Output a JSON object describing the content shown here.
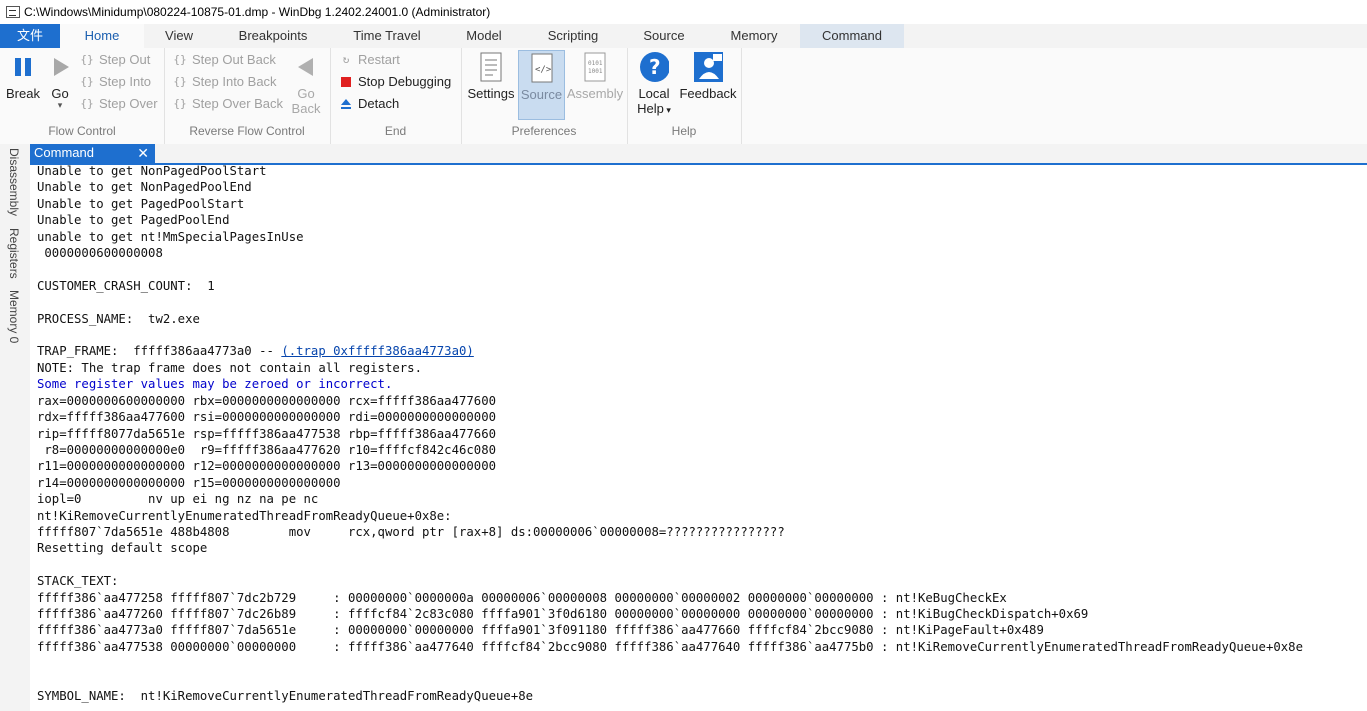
{
  "window": {
    "title": "C:\\Windows\\Minidump\\080224-10875-01.dmp - WinDbg 1.2402.24001.0 (Administrator)"
  },
  "tabs": [
    {
      "label": "文件"
    },
    {
      "label": "Home"
    },
    {
      "label": "View"
    },
    {
      "label": "Breakpoints"
    },
    {
      "label": "Time Travel"
    },
    {
      "label": "Model"
    },
    {
      "label": "Scripting"
    },
    {
      "label": "Source"
    },
    {
      "label": "Memory"
    },
    {
      "label": "Command"
    }
  ],
  "ribbon": {
    "flow_control": {
      "label": "Flow Control",
      "break": "Break",
      "go": "Go",
      "step_out": "Step Out",
      "step_into": "Step Into",
      "step_over": "Step Over"
    },
    "reverse_flow": {
      "label": "Reverse Flow Control",
      "step_out_back": "Step Out Back",
      "step_into_back": "Step Into Back",
      "step_over_back": "Step Over Back",
      "go_back_1": "Go",
      "go_back_2": "Back"
    },
    "end": {
      "label": "End",
      "restart": "Restart",
      "stop": "Stop Debugging",
      "detach": "Detach"
    },
    "preferences": {
      "label": "Preferences",
      "settings": "Settings",
      "source": "Source",
      "assembly": "Assembly"
    },
    "help": {
      "label": "Help",
      "local_help_1": "Local",
      "local_help_2": "Help",
      "feedback": "Feedback"
    }
  },
  "sidebar": {
    "disassembly": "Disassembly",
    "registers": "Registers",
    "memory": "Memory 0"
  },
  "panel": {
    "tab_label": "Command"
  },
  "output": {
    "l1": "Unable to get NonPagedPoolStart",
    "l2": "Unable to get NonPagedPoolEnd",
    "l3": "Unable to get PagedPoolStart",
    "l4": "Unable to get PagedPoolEnd",
    "l5": "unable to get nt!MmSpecialPagesInUse",
    "l6": " 0000000600000008",
    "l8": "CUSTOMER_CRASH_COUNT:  1",
    "l10": "PROCESS_NAME:  tw2.exe",
    "l12a": "TRAP_FRAME:  fffff386aa4773a0 -- ",
    "l12b": "(.trap 0xfffff386aa4773a0)",
    "l13": "NOTE: The trap frame does not contain all registers.",
    "l14": "Some register values may be zeroed or incorrect.",
    "l15": "rax=0000000600000000 rbx=0000000000000000 rcx=fffff386aa477600",
    "l16": "rdx=fffff386aa477600 rsi=0000000000000000 rdi=0000000000000000",
    "l17": "rip=fffff8077da5651e rsp=fffff386aa477538 rbp=fffff386aa477660",
    "l18": " r8=00000000000000e0  r9=fffff386aa477620 r10=ffffcf842c46c080",
    "l19": "r11=0000000000000000 r12=0000000000000000 r13=0000000000000000",
    "l20": "r14=0000000000000000 r15=0000000000000000",
    "l21": "iopl=0         nv up ei ng nz na pe nc",
    "l22": "nt!KiRemoveCurrentlyEnumeratedThreadFromReadyQueue+0x8e:",
    "l23": "fffff807`7da5651e 488b4808        mov     rcx,qword ptr [rax+8] ds:00000006`00000008=????????????????",
    "l24": "Resetting default scope",
    "l26": "STACK_TEXT:",
    "l27": "fffff386`aa477258 fffff807`7dc2b729     : 00000000`0000000a 00000006`00000008 00000000`00000002 00000000`00000000 : nt!KeBugCheckEx",
    "l28": "fffff386`aa477260 fffff807`7dc26b89     : ffffcf84`2c83c080 ffffa901`3f0d6180 00000000`00000000 00000000`00000000 : nt!KiBugCheckDispatch+0x69",
    "l29": "fffff386`aa4773a0 fffff807`7da5651e     : 00000000`00000000 ffffa901`3f091180 fffff386`aa477660 ffffcf84`2bcc9080 : nt!KiPageFault+0x489",
    "l30": "fffff386`aa477538 00000000`00000000     : fffff386`aa477640 ffffcf84`2bcc9080 fffff386`aa477640 fffff386`aa4775b0 : nt!KiRemoveCurrentlyEnumeratedThreadFromReadyQueue+0x8e",
    "l33": "SYMBOL_NAME:  nt!KiRemoveCurrentlyEnumeratedThreadFromReadyQueue+8e"
  },
  "colors": {
    "accent": "#1e6fcf",
    "stop_red": "#e02020",
    "link": "#0645ad",
    "note_blue": "#0000cc"
  }
}
